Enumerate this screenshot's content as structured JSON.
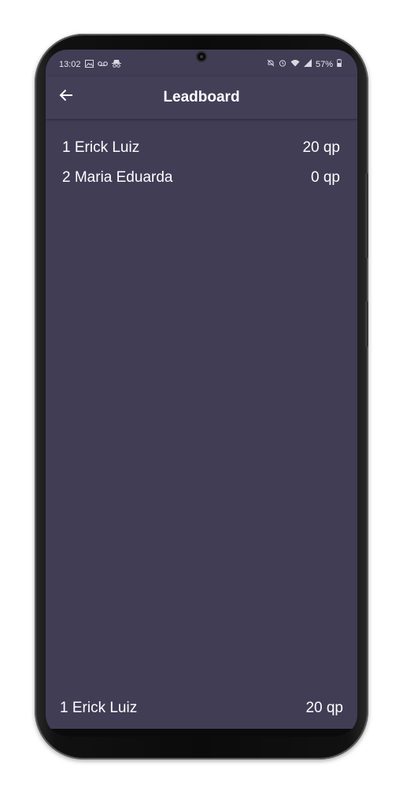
{
  "status_bar": {
    "time": "13:02",
    "left_icons": [
      "gallery-icon",
      "voicemail-icon",
      "incognito-icon"
    ],
    "right_icons": [
      "mute-icon",
      "alarm-icon",
      "wifi-icon",
      "signal-icon"
    ],
    "battery": "57%"
  },
  "app_bar": {
    "title": "Leadboard",
    "back_icon": "arrow-left-icon"
  },
  "leaderboard": {
    "rows": [
      {
        "name": "1 Erick Luiz",
        "score": "20 qp"
      },
      {
        "name": "2 Maria Eduarda",
        "score": "0 qp"
      }
    ]
  },
  "current_user": {
    "name": "1 Erick Luiz",
    "score": "20 qp"
  },
  "colors": {
    "background": "#403d55",
    "app_bar": "#423f57",
    "text": "#ffffff"
  }
}
